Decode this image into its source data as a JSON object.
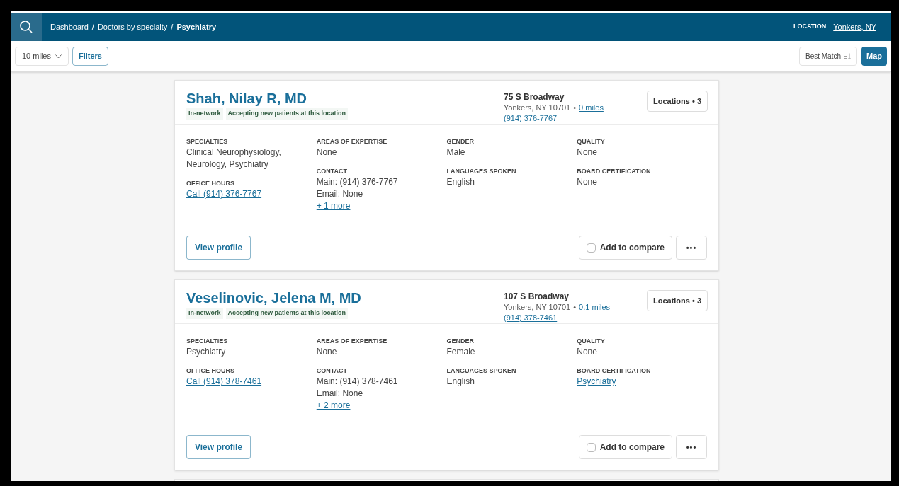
{
  "header": {
    "breadcrumbs": [
      {
        "label": "Dashboard",
        "current": false
      },
      {
        "label": "Doctors by specialty",
        "current": false
      },
      {
        "label": "Psychiatry",
        "current": true
      }
    ],
    "separator": "/",
    "location_label": "LOCATION",
    "location": "Yonkers, NY"
  },
  "toolbar": {
    "distance": "10 miles",
    "filters": "Filters",
    "sort": "Best Match",
    "map": "Map"
  },
  "doctors": [
    {
      "name": "Shah, Nilay R, MD",
      "tags": [
        "In-network",
        "Accepting new patients at this location"
      ],
      "address": "75 S Broadway",
      "city": "Yonkers, NY 10701",
      "bullet": "•",
      "distance": "0 miles",
      "phone": "(914) 376-7767",
      "locations": "Locations • 3",
      "columns": [
        [
          {
            "label": "SPECIALTIES",
            "lines": [
              {
                "kind": "text",
                "text": "Clinical Neurophysiology, Neurology, Psychiatry"
              }
            ]
          },
          {
            "label": "OFFICE HOURS",
            "lines": [
              {
                "kind": "link",
                "text": "Call (914) 376-7767"
              }
            ]
          }
        ],
        [
          {
            "label": "AREAS OF EXPERTISE",
            "lines": [
              {
                "kind": "text",
                "text": "None"
              }
            ]
          },
          {
            "label": "CONTACT",
            "lines": [
              {
                "kind": "text",
                "text": "Main: (914) 376-7767"
              },
              {
                "kind": "text",
                "text": "Email: None"
              },
              {
                "kind": "link",
                "text": "+ 1 more"
              }
            ]
          }
        ],
        [
          {
            "label": "GENDER",
            "lines": [
              {
                "kind": "text",
                "text": "Male"
              }
            ]
          },
          {
            "label": "LANGUAGES SPOKEN",
            "lines": [
              {
                "kind": "text",
                "text": "English"
              }
            ]
          }
        ],
        [
          {
            "label": "QUALITY",
            "lines": [
              {
                "kind": "text",
                "text": "None"
              }
            ]
          },
          {
            "label": "BOARD CERTIFICATION",
            "lines": [
              {
                "kind": "text",
                "text": "None"
              }
            ]
          }
        ]
      ],
      "view_profile": "View profile",
      "compare": {
        "label": "Add to compare",
        "checked": false
      },
      "more": "•••"
    },
    {
      "name": "Veselinovic, Jelena M, MD",
      "tags": [
        "In-network",
        "Accepting new patients at this location"
      ],
      "address": "107 S Broadway",
      "city": "Yonkers, NY 10701",
      "bullet": "•",
      "distance": "0.1 miles",
      "phone": "(914) 378-7461",
      "locations": "Locations • 3",
      "columns": [
        [
          {
            "label": "SPECIALTIES",
            "lines": [
              {
                "kind": "text",
                "text": "Psychiatry"
              }
            ]
          },
          {
            "label": "OFFICE HOURS",
            "lines": [
              {
                "kind": "link",
                "text": "Call (914) 378-7461"
              }
            ]
          }
        ],
        [
          {
            "label": "AREAS OF EXPERTISE",
            "lines": [
              {
                "kind": "text",
                "text": "None"
              }
            ]
          },
          {
            "label": "CONTACT",
            "lines": [
              {
                "kind": "text",
                "text": "Main: (914) 378-7461"
              },
              {
                "kind": "text",
                "text": "Email: None"
              },
              {
                "kind": "link",
                "text": "+ 2 more"
              }
            ]
          }
        ],
        [
          {
            "label": "GENDER",
            "lines": [
              {
                "kind": "text",
                "text": "Female"
              }
            ]
          },
          {
            "label": "LANGUAGES SPOKEN",
            "lines": [
              {
                "kind": "text",
                "text": "English"
              }
            ]
          }
        ],
        [
          {
            "label": "QUALITY",
            "lines": [
              {
                "kind": "text",
                "text": "None"
              }
            ]
          },
          {
            "label": "BOARD CERTIFICATION",
            "lines": [
              {
                "kind": "link",
                "text": "Psychiatry"
              }
            ]
          }
        ]
      ],
      "view_profile": "View profile",
      "compare": {
        "label": "Add to compare",
        "checked": false
      },
      "more": "•••"
    }
  ]
}
